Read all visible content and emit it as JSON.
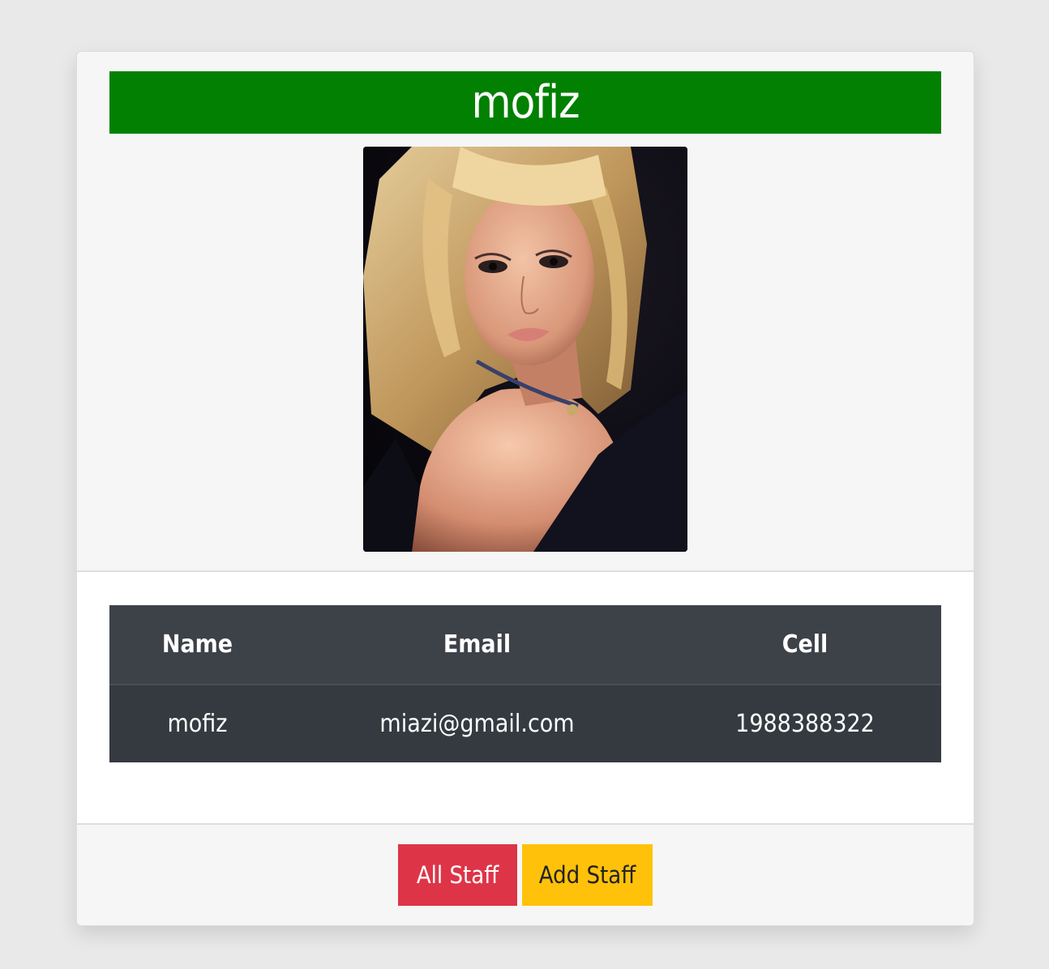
{
  "profile": {
    "title": "mofiz",
    "photo_alt": "Staff photo"
  },
  "table": {
    "headers": {
      "name": "Name",
      "email": "Email",
      "cell": "Cell"
    },
    "rows": [
      {
        "name": "mofiz",
        "email": "miazi@gmail.com",
        "cell": "1988388322"
      }
    ]
  },
  "footer": {
    "all_staff_label": "All Staff",
    "add_staff_label": "Add Staff"
  },
  "colors": {
    "title_bar": "#028002",
    "table_header": "#3d4148",
    "table_row": "#343a40",
    "danger": "#dd3547",
    "warning": "#ffc10a"
  }
}
